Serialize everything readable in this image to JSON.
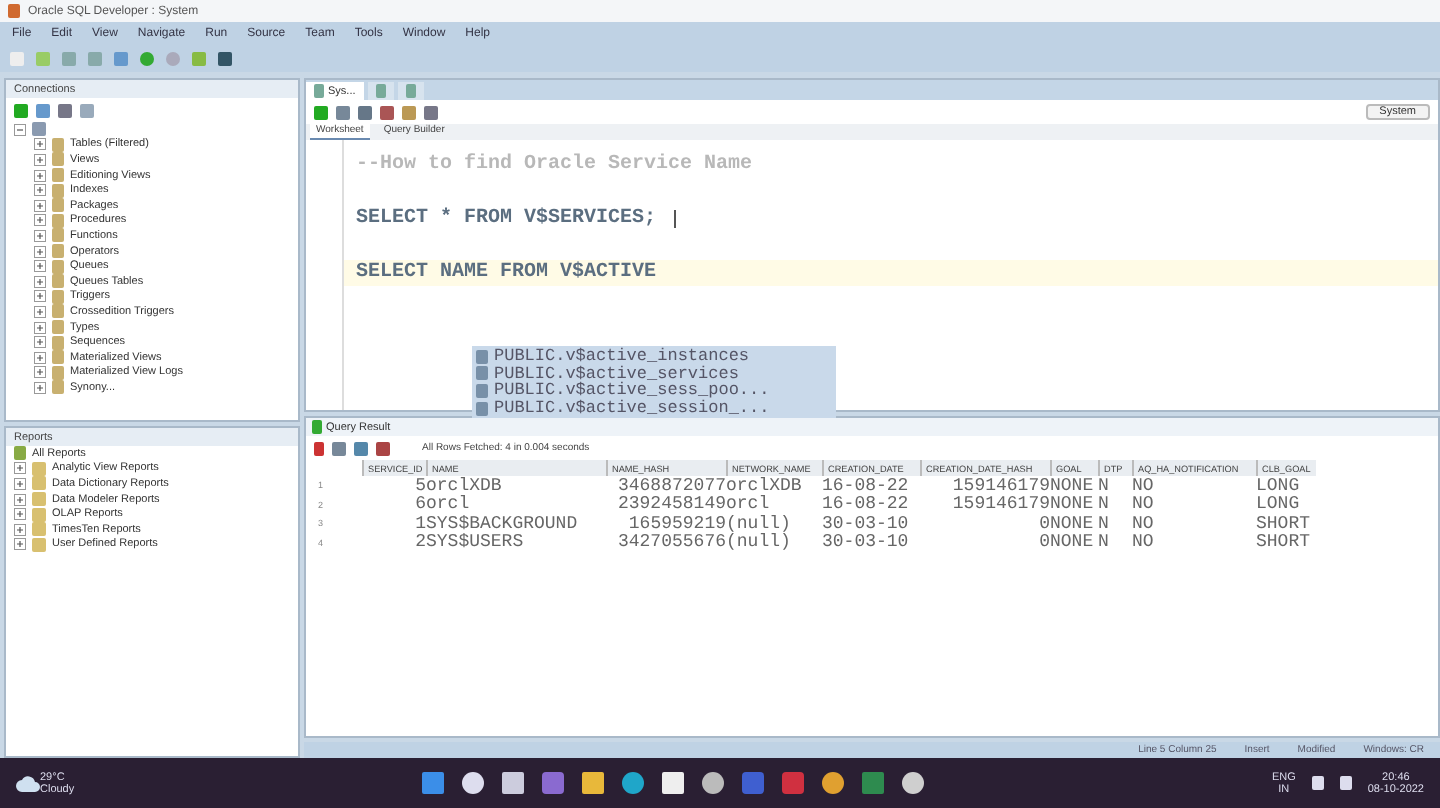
{
  "window": {
    "title": "Oracle SQL Developer : System"
  },
  "menu": [
    "File",
    "Edit",
    "View",
    "Navigate",
    "Run",
    "Source",
    "Team",
    "Tools",
    "Window",
    "Help"
  ],
  "connections": {
    "title": "Connections",
    "items": [
      {
        "label": "Tables (Filtered)",
        "expanded": false
      },
      {
        "label": "Views",
        "expanded": false
      },
      {
        "label": "Editioning Views",
        "expanded": false
      },
      {
        "label": "Indexes",
        "expanded": false
      },
      {
        "label": "Packages",
        "expanded": false
      },
      {
        "label": "Procedures",
        "expanded": false
      },
      {
        "label": "Functions",
        "expanded": false
      },
      {
        "label": "Operators",
        "expanded": false
      },
      {
        "label": "Queues",
        "expanded": false
      },
      {
        "label": "Queues Tables",
        "expanded": false
      },
      {
        "label": "Triggers",
        "expanded": false
      },
      {
        "label": "Crossedition Triggers",
        "expanded": false
      },
      {
        "label": "Types",
        "expanded": false
      },
      {
        "label": "Sequences",
        "expanded": false
      },
      {
        "label": "Materialized Views",
        "expanded": false
      },
      {
        "label": "Materialized View Logs",
        "expanded": false
      },
      {
        "label": "Synony...",
        "expanded": false
      }
    ]
  },
  "reports": {
    "title": "Reports",
    "root": "All Reports",
    "items": [
      {
        "label": "Analytic View Reports",
        "expanded": false
      },
      {
        "label": "Data Dictionary Reports",
        "expanded": false
      },
      {
        "label": "Data Modeler Reports",
        "expanded": false
      },
      {
        "label": "OLAP Reports",
        "expanded": false
      },
      {
        "label": "TimesTen Reports",
        "expanded": false
      },
      {
        "label": "User Defined Reports",
        "expanded": false
      }
    ]
  },
  "editor_tabs": [
    {
      "label": "Sys...",
      "selected": true
    },
    {
      "selected": false
    },
    {
      "selected": false
    }
  ],
  "connection_selector": "System",
  "worksheet_tabs": [
    {
      "label": "Worksheet",
      "selected": true
    },
    {
      "label": "Query Builder",
      "selected": false
    }
  ],
  "code_lines": [
    {
      "kind": "comment",
      "text": "--How to find Oracle Service Name",
      "current": false
    },
    {
      "kind": "code",
      "text": "SELECT * FROM V$SERVICES;",
      "current": false
    },
    {
      "kind": "code",
      "text": "SELECT NAME FROM V$ACTIVE",
      "current": true
    }
  ],
  "autocomplete": [
    "PUBLIC.v$active_instances",
    "PUBLIC.v$active_services",
    "PUBLIC.v$active_sess_poo...",
    "PUBLIC.v$active_session_..."
  ],
  "results": {
    "tab": "Query Result",
    "status": "All Rows Fetched: 4 in 0.004 seconds",
    "columns": [
      "SERVICE_ID",
      "NAME",
      "NAME_HASH",
      "NETWORK_NAME",
      "CREATION_DATE",
      "CREATION_DATE_HASH",
      "GOAL",
      "DTP",
      "AQ_HA_NOTIFICATION",
      "CLB_GOAL"
    ],
    "rows": [
      {
        "number": "1",
        "cells": [
          "5",
          "orclXDB",
          "3468872077",
          "orclXDB",
          "16-08-22",
          "159146179",
          "NONE",
          "N",
          "NO",
          "LONG"
        ]
      },
      {
        "number": "2",
        "cells": [
          "6",
          "orcl",
          "2392458149",
          "orcl",
          "16-08-22",
          "159146179",
          "NONE",
          "N",
          "NO",
          "LONG"
        ]
      },
      {
        "number": "3",
        "cells": [
          "1",
          "SYS$BACKGROUND",
          "165959219",
          "(null)",
          "30-03-10",
          "0",
          "NONE",
          "N",
          "NO",
          "SHORT"
        ]
      },
      {
        "number": "4",
        "cells": [
          "2",
          "SYS$USERS",
          "3427055676",
          "(null)",
          "30-03-10",
          "0",
          "NONE",
          "N",
          "NO",
          "SHORT"
        ]
      }
    ]
  },
  "status_bar": [
    "Line 5 Column 25",
    "Insert",
    "Modified",
    "Windows: CR"
  ],
  "taskbar": {
    "temperature": "29°C",
    "weather": "Cloudy",
    "language": "ENG",
    "region": "IN",
    "time": "20:46",
    "date": "08-10-2022"
  }
}
